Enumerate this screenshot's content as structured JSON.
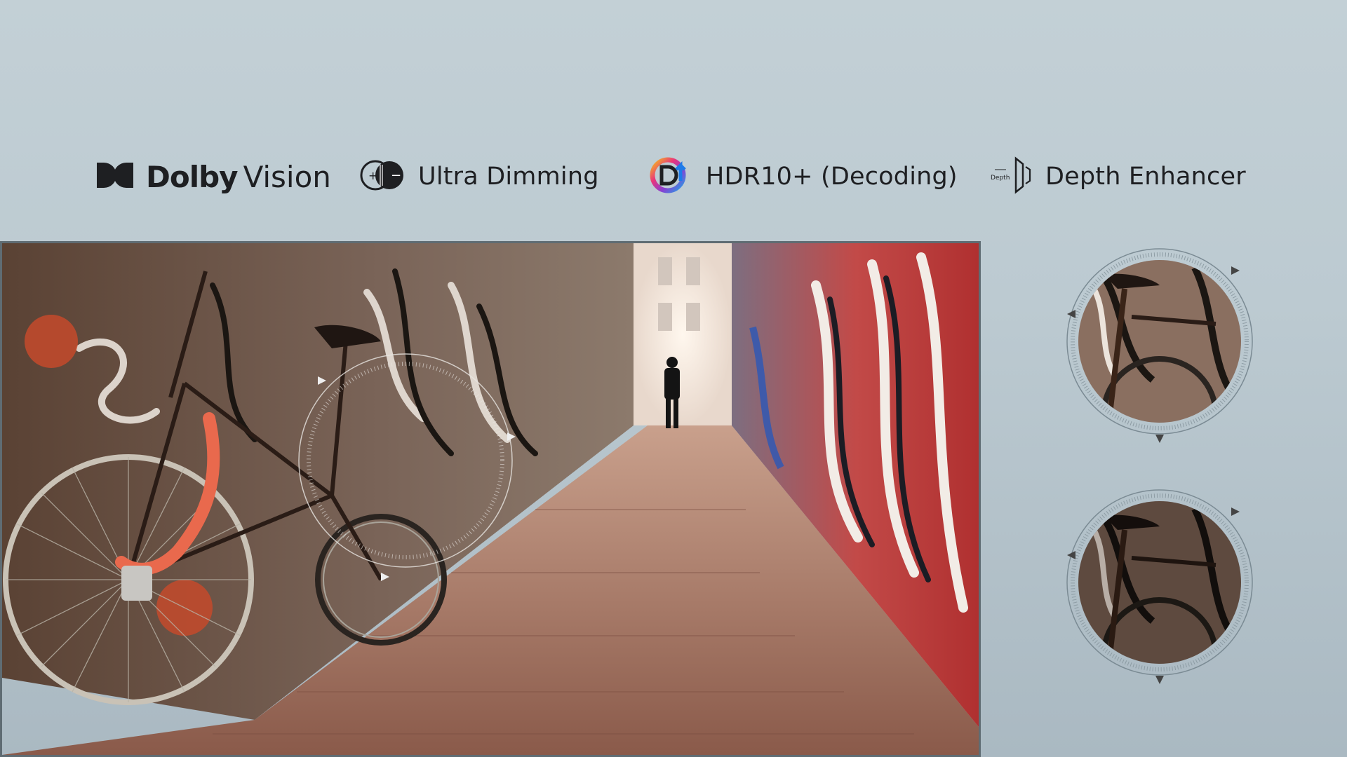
{
  "features": [
    {
      "name": "dolby-vision",
      "brand": "Dolby",
      "sub": "Vision",
      "icon": "dolby-logo-icon"
    },
    {
      "name": "ultra-dimming",
      "label": "Ultra Dimming",
      "icon": "dimming-icon"
    },
    {
      "name": "hdr10-plus",
      "label": "HDR10+ (Decoding)",
      "icon": "hdr-logo-icon"
    },
    {
      "name": "depth-enhancer",
      "label": "Depth Enhancer",
      "icon_text": "Depth",
      "icon": "depth-speaker-icon"
    }
  ],
  "colors": {
    "background_top": "#c3d0d6",
    "background_bottom": "#aab9c2",
    "text": "#1e1f22",
    "photo_border": "#5f6c73"
  }
}
